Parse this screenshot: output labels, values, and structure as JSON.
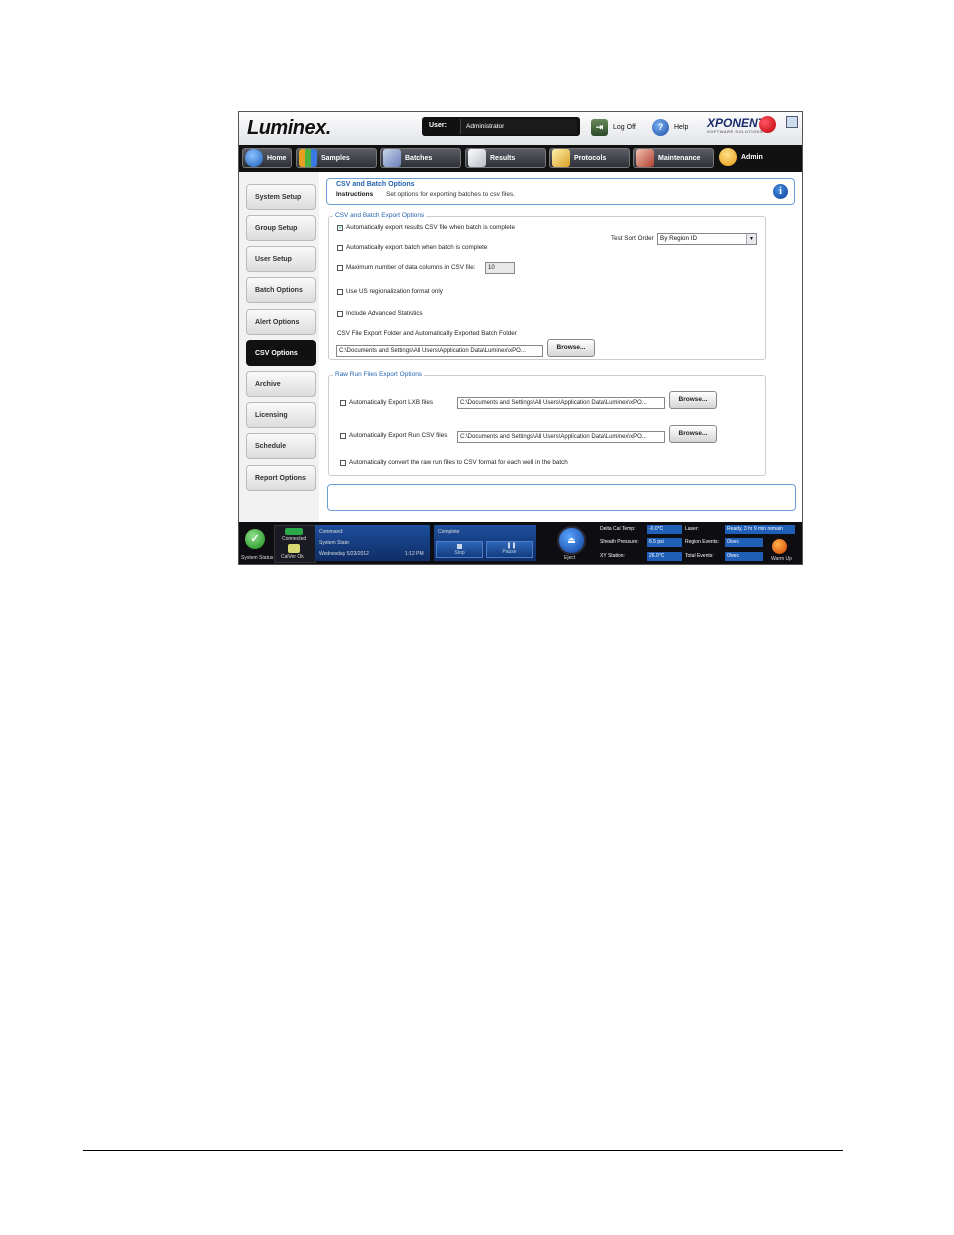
{
  "header": {
    "logo": "Luminex.",
    "user_label": "User:",
    "user_value": "Administrator",
    "logoff_label": "Log Off",
    "help_label": "Help",
    "brand": "XPONENT.",
    "brand_sub": "SOFTWARE SOLUTIONS"
  },
  "nav": {
    "tabs": [
      {
        "label": "Home",
        "icon": "home-icon",
        "color": "#3a8ad8"
      },
      {
        "label": "Samples",
        "icon": "samples-icon",
        "color": "#e6a020"
      },
      {
        "label": "Batches",
        "icon": "batches-icon",
        "color": "#9ab0d8"
      },
      {
        "label": "Results",
        "icon": "results-icon",
        "color": "#d0d4dc"
      },
      {
        "label": "Protocols",
        "icon": "protocols-icon",
        "color": "#e8c040"
      },
      {
        "label": "Maintenance",
        "icon": "maintenance-icon",
        "color": "#d06050"
      },
      {
        "label": "Admin",
        "icon": "admin-icon",
        "color": "#f0a020"
      }
    ]
  },
  "sidebar": {
    "items": [
      {
        "label": "System Setup"
      },
      {
        "label": "Group Setup"
      },
      {
        "label": "User Setup"
      },
      {
        "label": "Batch Options"
      },
      {
        "label": "Alert Options"
      },
      {
        "label": "CSV Options",
        "active": true
      },
      {
        "label": "Archive"
      },
      {
        "label": "Licensing"
      },
      {
        "label": "Schedule"
      },
      {
        "label": "Report Options"
      }
    ]
  },
  "main": {
    "title": "CSV and Batch Options",
    "instructions_label": "Instructions",
    "instructions_text": "Set options for exporting batches to csv files.",
    "export_group": {
      "legend": "CSV and Batch Export Options",
      "auto_csv": {
        "label": "Automatically export results CSV file when batch is complete",
        "checked": true
      },
      "auto_batch": {
        "label": "Automatically export batch when batch is complete",
        "checked": false
      },
      "max_cols": {
        "label": "Maximum number of data columns in CSV file:",
        "checked": false,
        "value": "10"
      },
      "us_region": {
        "label": "Use US regionalization format only",
        "checked": false
      },
      "adv_stats": {
        "label": "Include Advanced Statistics",
        "checked": false
      },
      "sort_label": "Test Sort Order",
      "sort_value": "By Region ID",
      "folder_label": "CSV File Export Folder and Automatically Exported Batch Folder",
      "folder_value": "C:\\Documents and Settings\\All Users\\Application Data\\Luminex\\xPO...",
      "browse": "Browse..."
    },
    "raw_group": {
      "legend": "Raw Run Files Export Options",
      "lxb": {
        "label": "Automatically Export LXB files",
        "checked": false,
        "path": "C:\\Documents and Settings\\All Users\\Application Data\\Luminex\\xPO...",
        "browse": "Browse..."
      },
      "runcsv": {
        "label": "Automatically Export Run CSV files",
        "checked": false,
        "path": "C:\\Documents and Settings\\All Users\\Application Data\\Luminex\\xPO...",
        "browse": "Browse..."
      },
      "convert": {
        "label": "Automatically convert the raw run files to CSV format for each well in the batch",
        "checked": false
      }
    }
  },
  "status": {
    "system_status": "System Status",
    "connected": "Connected",
    "calver": "CalVer Ok",
    "command_label": "Command:",
    "state_label": "System State:",
    "date": "Wednesday 5/23/2012",
    "time": "1:12 PM",
    "run_state": "Complete",
    "stop": "Stop",
    "pause": "Pause",
    "eject": "Eject",
    "delta_label": "Delta Cal Temp:",
    "delta_value": "-0.0°C",
    "sheath_label": "Sheath Pressure:",
    "sheath_value": "6.5 psi",
    "xy_label": "XY Station:",
    "xy_value": "26.0°C",
    "laser_label": "Laser:",
    "laser_value": "Ready, 3 hr 9 min remain",
    "region_label": "Region Events:",
    "region_value": "0/sec",
    "total_label": "Total Events:",
    "total_value": "0/sec",
    "warmup": "Warm Up"
  }
}
